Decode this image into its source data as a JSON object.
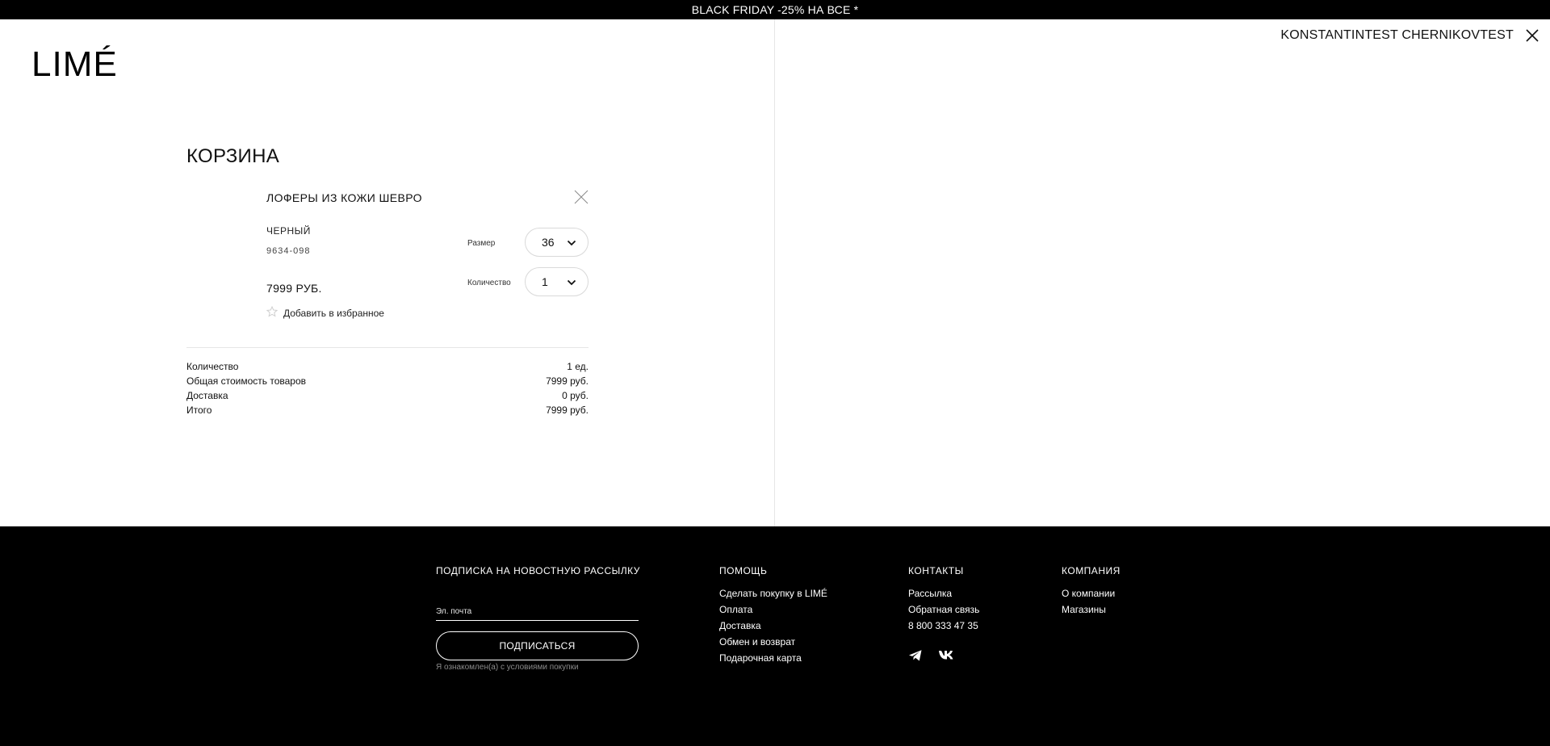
{
  "promo": {
    "text": "BLACK FRIDAY -25% НА ВСЕ *"
  },
  "brand": {
    "logo_text": "LIMÉ"
  },
  "header": {
    "user_name": "KONSTANTINTEST CHERNIKOVTEST"
  },
  "cart": {
    "title": "КОРЗИНА",
    "item": {
      "name": "ЛОФЕРЫ ИЗ КОЖИ ШЕВРО",
      "color": "ЧЕРНЫЙ",
      "sku": "9634-098",
      "price": "7999 РУБ.",
      "favorite_label": "Добавить в избранное",
      "size_label": "Размер",
      "size_value": "36",
      "qty_label": "Количество",
      "qty_value": "1"
    },
    "summary": [
      {
        "label": "Количество",
        "value": "1 ед."
      },
      {
        "label": "Общая стоимость товаров",
        "value": "7999 руб."
      },
      {
        "label": "Доставка",
        "value": "0 руб."
      },
      {
        "label": "Итого",
        "value": "7999 руб."
      }
    ]
  },
  "footer": {
    "newsletter": {
      "heading": "ПОДПИСКА НА НОВОСТНУЮ РАССЫЛКУ",
      "email_placeholder": "Эл. почта",
      "button_label": "ПОДПИСАТЬСЯ",
      "terms": "Я ознакомлен(а) с условиями покупки"
    },
    "help": {
      "heading": "ПОМОЩЬ",
      "links": [
        "Сделать покупку в LIMÉ",
        "Оплата",
        "Доставка",
        "Обмен и возврат",
        "Подарочная карта"
      ]
    },
    "contacts": {
      "heading": "КОНТАКТЫ",
      "links": [
        "Рассылка",
        "Обратная связь",
        "8 800 333 47 35"
      ],
      "social": [
        "telegram-icon",
        "vk-icon"
      ]
    },
    "company": {
      "heading": "КОМПАНИЯ",
      "links": [
        "О компании",
        "Магазины"
      ]
    }
  }
}
